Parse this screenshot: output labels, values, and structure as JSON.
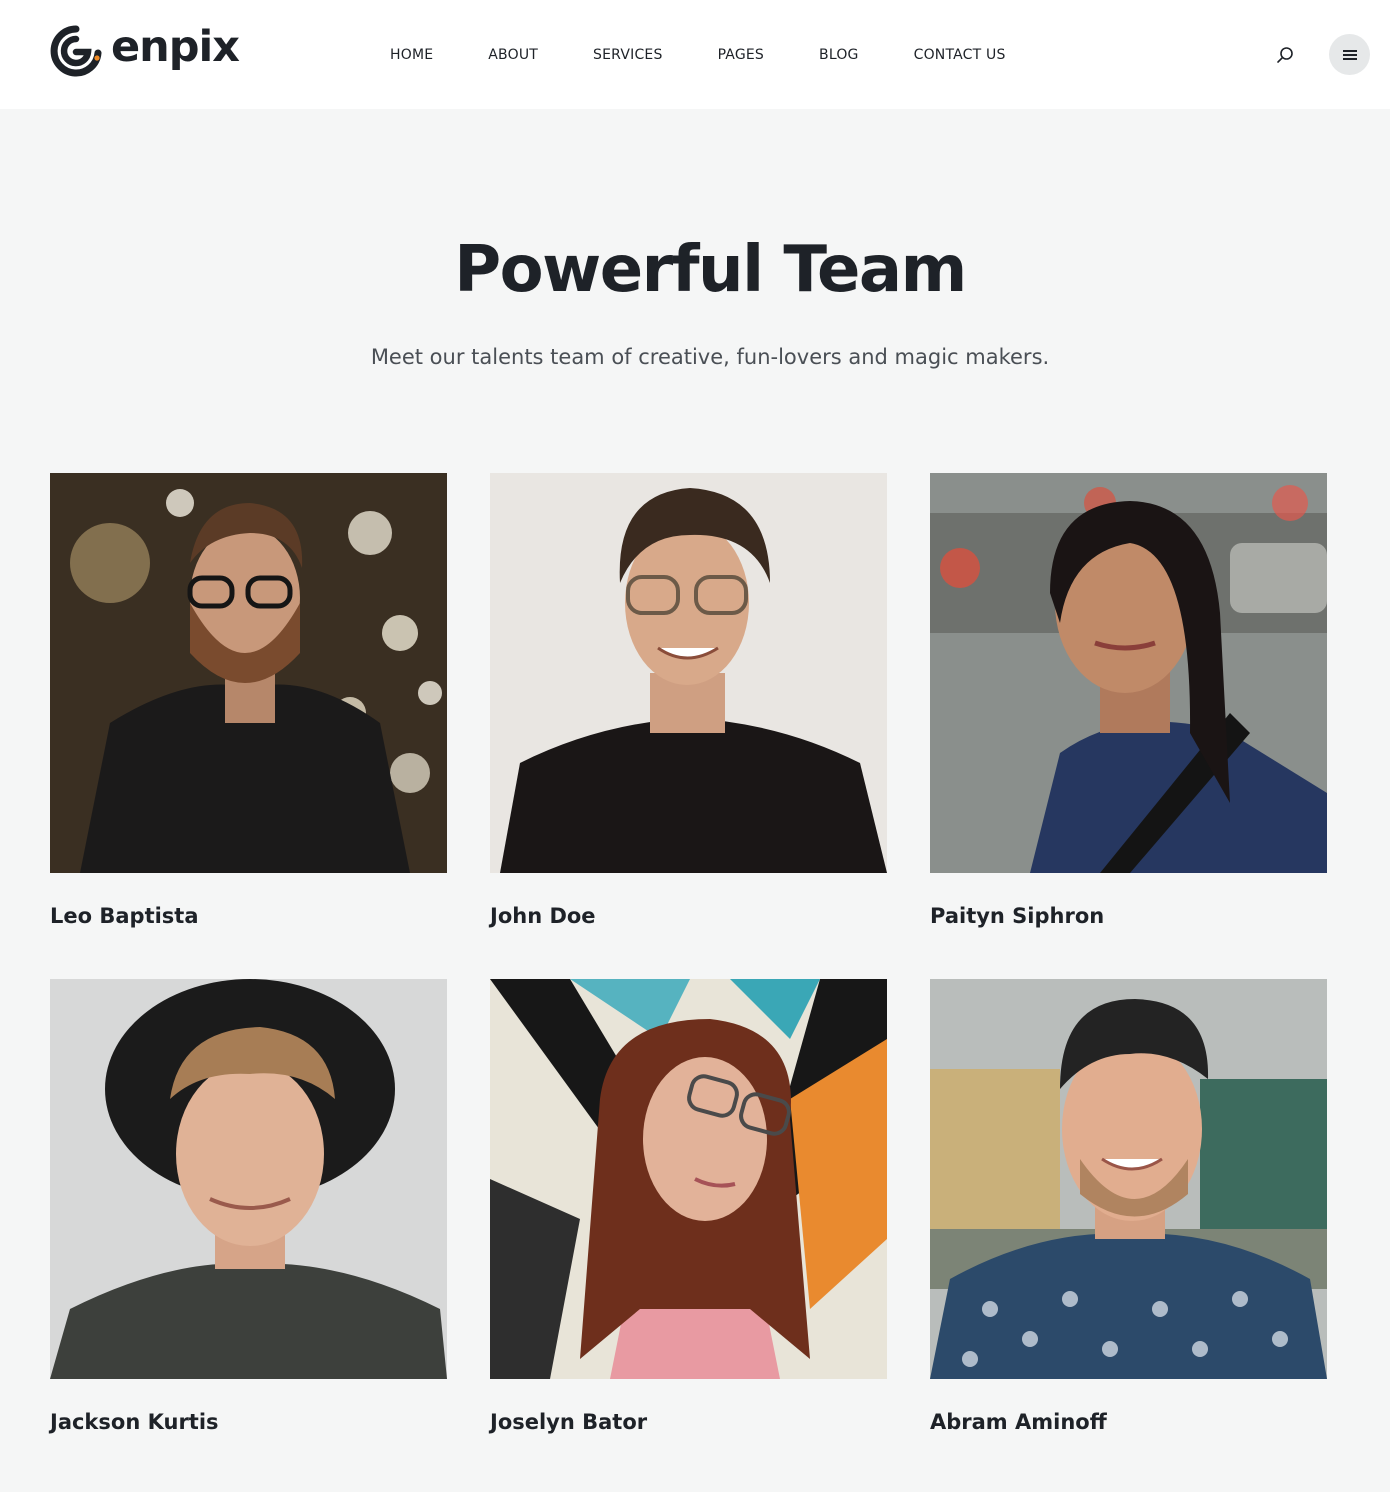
{
  "brand": {
    "name": "enpix",
    "accent_color": "#f08a24",
    "text_color": "#1e2228"
  },
  "nav": {
    "items": [
      {
        "label": "HOME"
      },
      {
        "label": "ABOUT"
      },
      {
        "label": "SERVICES"
      },
      {
        "label": "PAGES"
      },
      {
        "label": "BLOG"
      },
      {
        "label": "CONTACT US"
      }
    ],
    "search_icon": "search-icon",
    "menu_icon": "hamburger-menu-icon"
  },
  "hero": {
    "title": "Powerful Team",
    "subtitle": "Meet our talents team of creative, fun-lovers and magic makers."
  },
  "team": {
    "members": [
      {
        "name": "Leo Baptista"
      },
      {
        "name": "John Doe"
      },
      {
        "name": "Paityn Siphron"
      },
      {
        "name": "Jackson Kurtis"
      },
      {
        "name": "Joselyn Bator"
      },
      {
        "name": "Abram Aminoff"
      }
    ]
  }
}
